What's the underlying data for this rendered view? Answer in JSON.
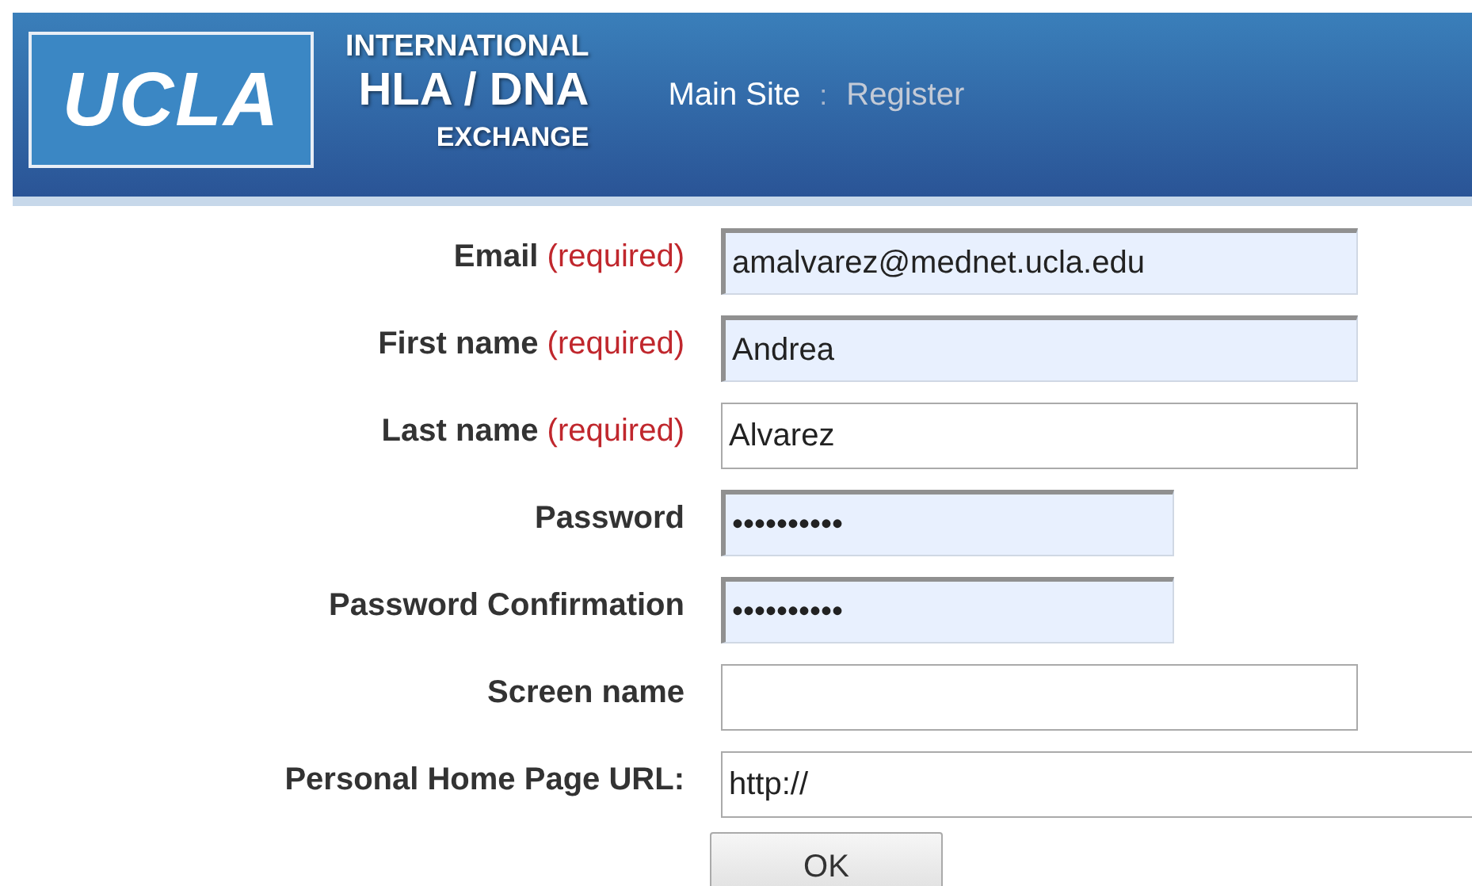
{
  "header": {
    "logo": "UCLA",
    "title_lines": [
      "INTERNATIONAL",
      "HLA / DNA",
      "EXCHANGE"
    ],
    "nav": [
      {
        "label": "Main Site",
        "selected": false
      },
      {
        "label": "Register",
        "selected": true
      }
    ],
    "separator": ":"
  },
  "form": {
    "fields": [
      {
        "label": "Email",
        "required_text": "(required)",
        "kind": "text",
        "value": "amalvarez@mednet.ucla.edu",
        "autofilled": true
      },
      {
        "label": "First name",
        "required_text": "(required)",
        "kind": "text",
        "value": "Andrea",
        "autofilled": true
      },
      {
        "label": "Last name",
        "required_text": "(required)",
        "kind": "text",
        "value": "Alvarez",
        "autofilled": false
      },
      {
        "label": "Password",
        "kind": "password",
        "value": "••••••••••",
        "autofilled": true
      },
      {
        "label": "Password Confirmation",
        "kind": "password",
        "value": "••••••••••",
        "autofilled": true
      },
      {
        "label": "Screen name",
        "kind": "text",
        "autofilled": false
      },
      {
        "label": "Personal Home Page URL:",
        "kind": "url",
        "value": "http://",
        "autofilled": false
      }
    ],
    "submit": "OK"
  }
}
